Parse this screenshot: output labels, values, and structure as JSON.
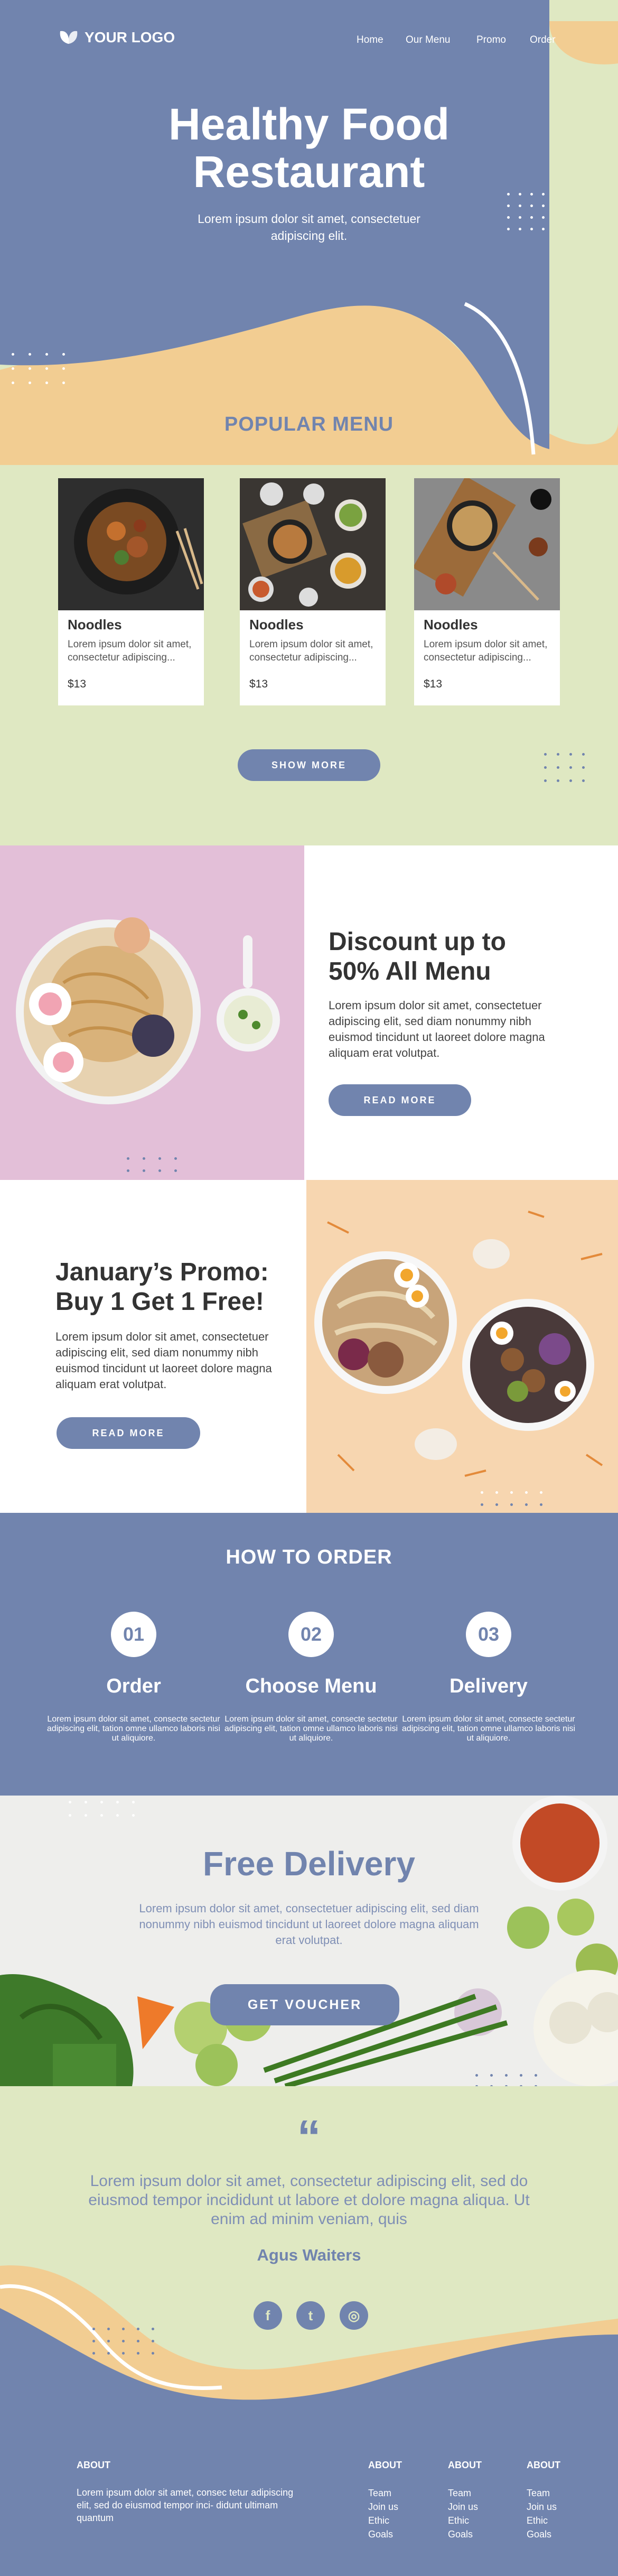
{
  "colors": {
    "primary": "#7184ae",
    "cream": "#dfe8c2",
    "peach": "#f2cd92",
    "white": "#ffffff"
  },
  "header": {
    "logo_text": "YOUR LOGO",
    "logo_icon": "leaf-icon",
    "nav": [
      "Home",
      "Our Menu",
      "Promo",
      "Order"
    ]
  },
  "hero": {
    "title_line1": "Healthy Food",
    "title_line2": "Restaurant",
    "subtitle": "Lorem ipsum dolor sit amet, consectetuer adipiscing elit."
  },
  "popular": {
    "title": "POPULAR MENU",
    "items": [
      {
        "name": "Noodles",
        "desc": "Lorem ipsum dolor sit amet, consectetur adipiscing...",
        "price": "$13"
      },
      {
        "name": "Noodles",
        "desc": "Lorem ipsum dolor sit amet, consectetur adipiscing...",
        "price": "$13"
      },
      {
        "name": "Noodles",
        "desc": "Lorem ipsum dolor sit amet, consectetur adipiscing...",
        "price": "$13"
      }
    ],
    "button": "SHOW MORE"
  },
  "discount": {
    "title_line1": "Discount up to",
    "title_line2": "50% All Menu",
    "text": "Lorem ipsum dolor sit amet, consectetuer adipiscing elit, sed diam nonummy nibh euismod tincidunt ut laoreet dolore magna aliquam erat volutpat.",
    "button": "READ MORE"
  },
  "january": {
    "title_line1": "January’s Promo:",
    "title_line2": "Buy 1 Get 1 Free!",
    "text": "Lorem ipsum dolor sit amet, consectetuer adipiscing elit, sed diam nonummy nibh euismod tincidunt ut laoreet dolore magna aliquam erat volutpat.",
    "button": "READ MORE"
  },
  "how_to_order": {
    "title": "HOW TO ORDER",
    "steps": [
      {
        "num": "01",
        "title": "Order",
        "desc": "Lorem ipsum dolor sit amet, consecte sectetur adipiscing elit, tation omne ullamco laboris nisi ut aliquiore."
      },
      {
        "num": "02",
        "title": "Choose Menu",
        "desc": "Lorem ipsum dolor sit amet, consecte sectetur adipiscing elit, tation omne ullamco laboris nisi ut aliquiore."
      },
      {
        "num": "03",
        "title": "Delivery",
        "desc": "Lorem ipsum dolor sit amet, consecte sectetur adipiscing elit, tation omne ullamco laboris nisi ut aliquiore."
      }
    ]
  },
  "delivery": {
    "title": "Free Delivery",
    "text": "Lorem ipsum dolor sit amet, consectetuer adipiscing elit, sed diam nonummy nibh euismod tincidunt ut laoreet dolore magna aliquam erat volutpat.",
    "button": "GET VOUCHER"
  },
  "testimonial": {
    "quote_mark": "“",
    "quote": "Lorem ipsum dolor sit amet, consectetur adipiscing elit, sed do eiusmod tempor incididunt ut labore et dolore magna aliqua. Ut enim ad minim veniam, quis",
    "author": "Agus Waiters",
    "social": [
      {
        "icon": "facebook-icon",
        "glyph": "f"
      },
      {
        "icon": "twitter-icon",
        "glyph": "t"
      },
      {
        "icon": "instagram-icon",
        "glyph": "◎"
      }
    ]
  },
  "footer": {
    "about_title": "ABOUT",
    "about_text": "Lorem ipsum dolor sit amet, consec tetur adipiscing elit, sed do eiusmod tempor inci- didunt ultimam quantum",
    "columns": [
      {
        "title": "ABOUT",
        "items": [
          "Team",
          "Join us",
          "Ethic",
          "Goals"
        ]
      },
      {
        "title": "ABOUT",
        "items": [
          "Team",
          "Join us",
          "Ethic",
          "Goals"
        ]
      },
      {
        "title": "ABOUT",
        "items": [
          "Team",
          "Join us",
          "Ethic",
          "Goals"
        ]
      }
    ]
  }
}
